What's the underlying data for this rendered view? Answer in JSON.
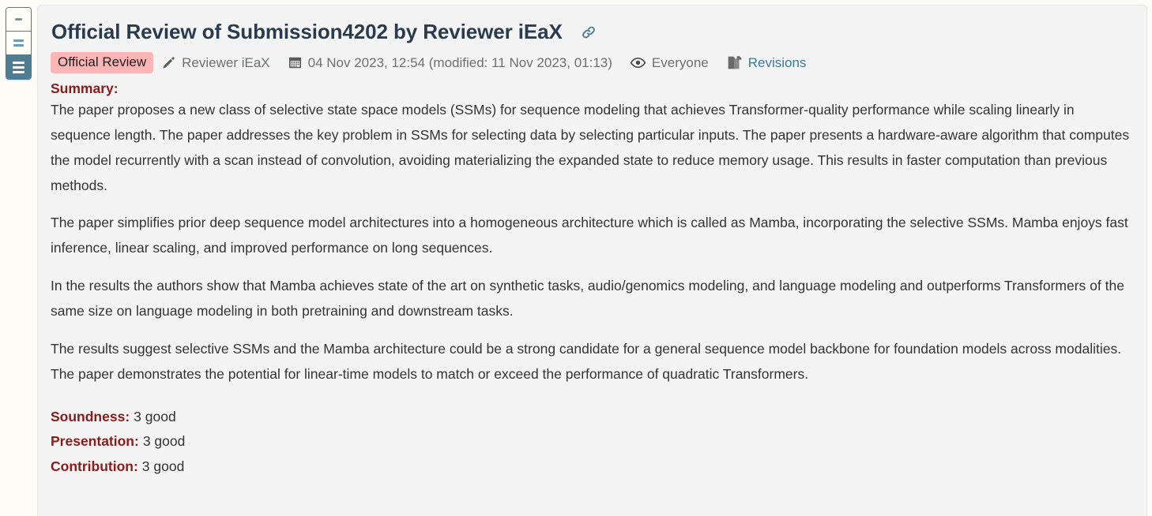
{
  "view_toggle": {
    "name": "text-density-toggle",
    "options": [
      {
        "id": "compact",
        "lines": 1,
        "active": false
      },
      {
        "id": "medium",
        "lines": 2,
        "active": false
      },
      {
        "id": "expanded",
        "lines": 3,
        "active": true
      }
    ]
  },
  "note": {
    "title": "Official Review of Submission4202 by Reviewer iEaX",
    "link_icon": "chain-link-icon",
    "meta": {
      "invitation_badge": "Official Review",
      "signature_icon": "pencil-icon",
      "signature": "Reviewer iEaX",
      "date_icon": "calendar-icon",
      "date": "04 Nov 2023, 12:54 (modified: 11 Nov 2023, 01:13)",
      "readers_icon": "eye-icon",
      "readers": "Everyone",
      "revisions_icon": "pages-icon",
      "revisions": "Revisions"
    },
    "summary": {
      "label": "Summary:",
      "paragraphs": [
        "The paper proposes a new class of selective state space models (SSMs) for sequence modeling that achieves Transformer-quality performance while scaling linearly in sequence length. The paper addresses the key problem in SSMs for selecting data by selecting particular inputs. The paper presents a hardware-aware algorithm that computes the model recurrently with a scan instead of convolution, avoiding materializing the expanded state to reduce memory usage. This results in faster computation than previous methods.",
        "The paper simplifies prior deep sequence model architectures into a homogeneous architecture which is called as Mamba, incorporating the selective SSMs. Mamba enjoys fast inference, linear scaling, and improved performance on long sequences.",
        "In the results the authors show that Mamba achieves state of the art on synthetic tasks, audio/genomics modeling, and language modeling and outperforms Transformers of the same size on language modeling in both pretraining and downstream tasks.",
        "The results suggest selective SSMs and the Mamba architecture could be a strong candidate for a general sequence model backbone for foundation models across modalities. The paper demonstrates the potential for linear-time models to match or exceed the performance of quadratic Transformers."
      ]
    },
    "ratings": [
      {
        "label": "Soundness:",
        "value": "3 good"
      },
      {
        "label": "Presentation:",
        "value": "3 good"
      },
      {
        "label": "Contribution:",
        "value": "3 good"
      }
    ]
  },
  "colors": {
    "page_background": "#fdfcf7",
    "card_background": "#f4f4f4",
    "title": "#2a3b4d",
    "field_heading": "#8b1a1a",
    "badge_background": "#fcb6b6",
    "link": "#3a7a96",
    "accent_teal": "#4d7e94",
    "body_text": "#333333",
    "meta_text": "#6f6f6f"
  }
}
